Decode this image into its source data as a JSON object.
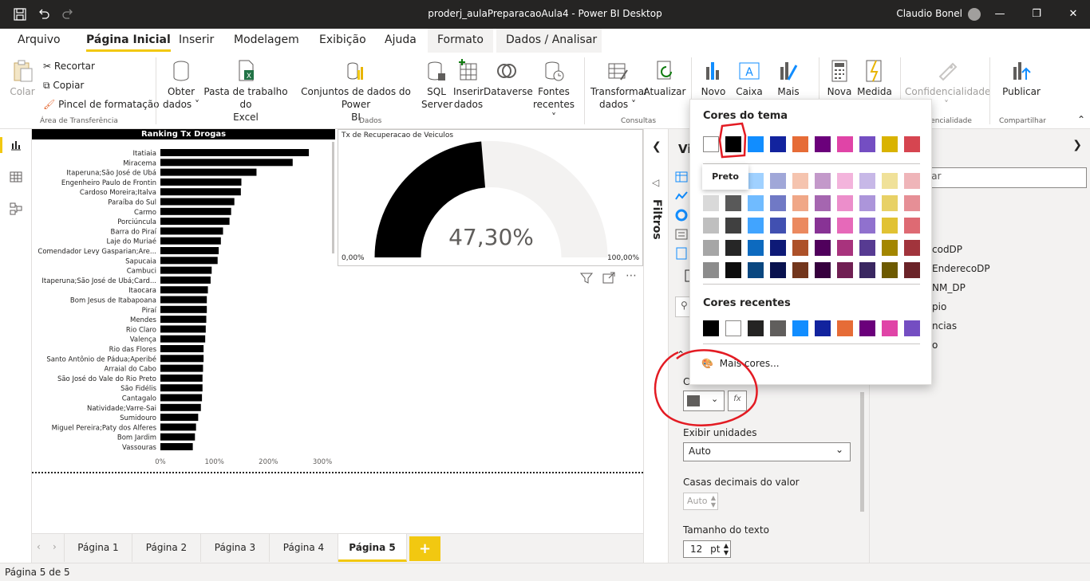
{
  "app": {
    "title": "proderj_aulaPreparacaoAula4 - Power BI Desktop",
    "user": "Claudio Bonel"
  },
  "ribbon_tabs": [
    {
      "label": "Arquivo"
    },
    {
      "label": "Página Inicial"
    },
    {
      "label": "Inserir"
    },
    {
      "label": "Modelagem"
    },
    {
      "label": "Exibição"
    },
    {
      "label": "Ajuda"
    },
    {
      "label": "Formato"
    },
    {
      "label": "Dados / Analisar"
    }
  ],
  "ribbon": {
    "clipboard": {
      "paste": "Colar",
      "cut": "Recortar",
      "copy": "Copiar",
      "format_painter": "Pincel de formatação",
      "group": "Área de Transferência"
    },
    "data": {
      "get_data_l1": "Obter",
      "get_data_l2": "dados",
      "excel_l1": "Pasta de trabalho do",
      "excel_l2": "Excel",
      "datasets_l1": "Conjuntos de dados do Power",
      "datasets_l2": "BI",
      "sql_l1": "SQL",
      "sql_l2": "Server",
      "enter_l1": "Inserir",
      "enter_l2": "dados",
      "dataverse": "Dataverse",
      "recent_l1": "Fontes",
      "recent_l2": "recentes",
      "group": "Dados"
    },
    "queries": {
      "transform_l1": "Transformar",
      "transform_l2": "dados",
      "refresh": "Atualizar",
      "group": "Consultas"
    },
    "insert": {
      "new_visual": "Novo",
      "text_box": "Caixa de",
      "more": "Mais"
    },
    "calc": {
      "new": "Nova",
      "measure": "Medida"
    },
    "sensitivity": {
      "label": "Confidencialidade",
      "group": "idencialidade"
    },
    "share": {
      "publish": "Publicar",
      "group": "Compartilhar"
    }
  },
  "chart_data": [
    {
      "type": "bar",
      "title": "Ranking Tx Drogas",
      "orientation": "horizontal",
      "categories": [
        "Itatiaia",
        "Miracema",
        "Itaperuna;São José de Ubá",
        "Engenheiro Paulo de Frontin",
        "Cardoso Moreira;Italva",
        "Paraíba do Sul",
        "Carmo",
        "Porciúncula",
        "Barra do Piraí",
        "Laje do Muriaé",
        "Comendador Levy Gasparian;Are...",
        "Sapucaia",
        "Cambuci",
        "Itaperuna;São José de Ubá;Card...",
        "Itaocara",
        "Bom Jesus de Itabapoana",
        "Piraí",
        "Mendes",
        "Rio Claro",
        "Valença",
        "Rio das Flores",
        "Santo Antônio de Pádua;Aperibé",
        "Arraial do Cabo",
        "São José do Vale do Rio Preto",
        "São Fidélis",
        "Cantagalo",
        "Natividade;Varre-Sai",
        "Sumidouro",
        "Miguel Pereira;Paty dos Alferes",
        "Bom Jardim",
        "Vassouras"
      ],
      "values": [
        275,
        245,
        178,
        150,
        149,
        137,
        131,
        128,
        116,
        112,
        108,
        106,
        95,
        93,
        88,
        86,
        86,
        85,
        84,
        83,
        80,
        80,
        79,
        78,
        78,
        77,
        75,
        70,
        66,
        64,
        60
      ],
      "xticks": [
        "0%",
        "100%",
        "200%",
        "300%"
      ],
      "xlim": [
        0,
        300
      ],
      "color": "#000000"
    },
    {
      "type": "gauge",
      "title": "Tx de Recuperacao de Veiculos",
      "value": 47.3,
      "value_label": "47,30%",
      "min_label": "0,00%",
      "max_label": "100,00%",
      "fill_color": "#000000",
      "track_color": "#f3f2f1"
    }
  ],
  "pages": [
    {
      "label": "Página 1"
    },
    {
      "label": "Página 2"
    },
    {
      "label": "Página 3"
    },
    {
      "label": "Página 4"
    },
    {
      "label": "Página 5",
      "active": true
    }
  ],
  "add_page": "+",
  "status": "Página 5 de 5",
  "filters_label": "Filtros",
  "viz_pane": {
    "title_partial": "Vi",
    "color_label_partial": "C",
    "fx_label": "fx",
    "display_units_label": "Exibir unidades",
    "display_units_value": "Auto",
    "decimals_label": "Casas decimais do valor",
    "decimals_value": "Auto",
    "text_size_label": "Tamanho do texto",
    "text_size_value": "12",
    "text_size_unit": "pt"
  },
  "fields_pane": {
    "search_partial": "sar",
    "items": [
      "codDP",
      "EnderecoDP",
      "NM_DP",
      "pio",
      "ncias",
      "o"
    ]
  },
  "color_picker": {
    "theme_title": "Cores do tema",
    "recent_title": "Cores recentes",
    "more_colors": "Mais cores...",
    "tooltip": "Preto",
    "theme_colors": [
      "#ffffff",
      "#000000",
      "#118dff",
      "#12239e",
      "#e66c37",
      "#6b007b",
      "#e044a7",
      "#744ec2",
      "#d9b300",
      "#d64550"
    ],
    "shade_rows": [
      [
        "#f2f2f2",
        "#808080",
        "#a0d1ff",
        "#a0a7d8",
        "#f5c4af",
        "#c399ca",
        "#f3b4dc",
        "#c7b8e7",
        "#f0e199",
        "#efb5b9"
      ],
      [
        "#d9d9d9",
        "#595959",
        "#70bbff",
        "#7079c5",
        "#f0a787",
        "#a566b0",
        "#ec8ecb",
        "#ac95da",
        "#e8d166",
        "#e68f96"
      ],
      [
        "#bfbfbf",
        "#404040",
        "#41a4ff",
        "#4150b1",
        "#eb895f",
        "#883395",
        "#e669b9",
        "#9071ce",
        "#e1c233",
        "#de6a73"
      ],
      [
        "#a6a6a6",
        "#262626",
        "#0d6abf",
        "#0e1a77",
        "#ad5129",
        "#50005c",
        "#a8337d",
        "#573b92",
        "#a38600",
        "#a1343c"
      ],
      [
        "#8c8c8c",
        "#0d0d0d",
        "#094780",
        "#09124f",
        "#73361c",
        "#36003e",
        "#701f53",
        "#3a2761",
        "#6d5a00",
        "#6b2328"
      ]
    ],
    "recent_colors": [
      "#000000",
      "#ffffff",
      "#252423",
      "#605e5c",
      "#118dff",
      "#12239e",
      "#e66c37",
      "#6b007b",
      "#e044a7",
      "#744ec2"
    ]
  }
}
